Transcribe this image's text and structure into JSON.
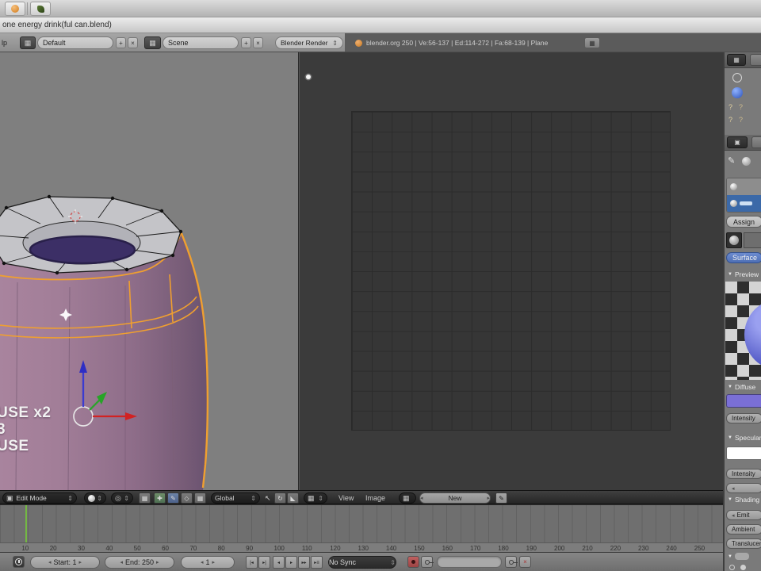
{
  "titlebar": {
    "title": "one energy drink(ful can.blend)"
  },
  "icons": {
    "updown": "⇕",
    "left_arrow": "◂",
    "right_arrow": "▸",
    "plus": "+",
    "close": "×",
    "grid": "▦",
    "image": "▦",
    "pencil": "✎",
    "cube": "▣",
    "sphere": "●",
    "pivot": "◎",
    "pointer": "↖",
    "rotate": "↻",
    "corner": "◣",
    "tri_down": "▼",
    "question": "?",
    "diamond": "◇",
    "axis": "✚"
  },
  "info_header": {
    "menu_tail": "lp",
    "layout_value": "Default",
    "scene_value": "Scene",
    "engine_value": "Blender Render",
    "status": "blender.org 250 | Ve:56-137 | Ed:114-272 | Fa:68-139 | Plane"
  },
  "viewport_3d": {
    "header": {
      "mode": "Edit Mode",
      "orientation": "Global"
    },
    "screencast_keys": [
      "USE x2",
      "3",
      "USE"
    ]
  },
  "uv_editor": {
    "header": {
      "menus": [
        "View",
        "Image"
      ],
      "datablock_button": "New"
    }
  },
  "timeline": {
    "ruler_labels": [
      "10",
      "20",
      "30",
      "40",
      "50",
      "60",
      "70",
      "80",
      "90",
      "100",
      "110",
      "120",
      "130",
      "140",
      "150",
      "160",
      "170",
      "180",
      "190",
      "200",
      "210",
      "220",
      "230",
      "240",
      "250"
    ],
    "header": {
      "start": "Start: 1",
      "end": "End: 250",
      "current_frame": "1",
      "playback_glyphs": [
        "|◂",
        "▸|",
        "◂",
        "▸",
        "▸▸",
        "▸≡"
      ],
      "sync": "No Sync"
    }
  },
  "properties_panel": {
    "buttons": {
      "assign": "Assign",
      "surface": "Surface"
    },
    "panel_headers": {
      "preview": "Preview",
      "diffuse": "Diffuse",
      "specular": "Specular",
      "shading": "Shading"
    },
    "sliders": {
      "diffuse_intensity": "Intensity",
      "specular_intensity": "Intensity",
      "emit": "Emit",
      "ambient": "Ambient",
      "translucency": "Translucency"
    },
    "colors": {
      "diffuse_swatch": "#7a6fd6",
      "specular_swatch": "#ffffff",
      "selected_slot": "#3b69a8",
      "surface_button": "#5e7fc4",
      "selection_orange": "#ef9f30"
    }
  }
}
